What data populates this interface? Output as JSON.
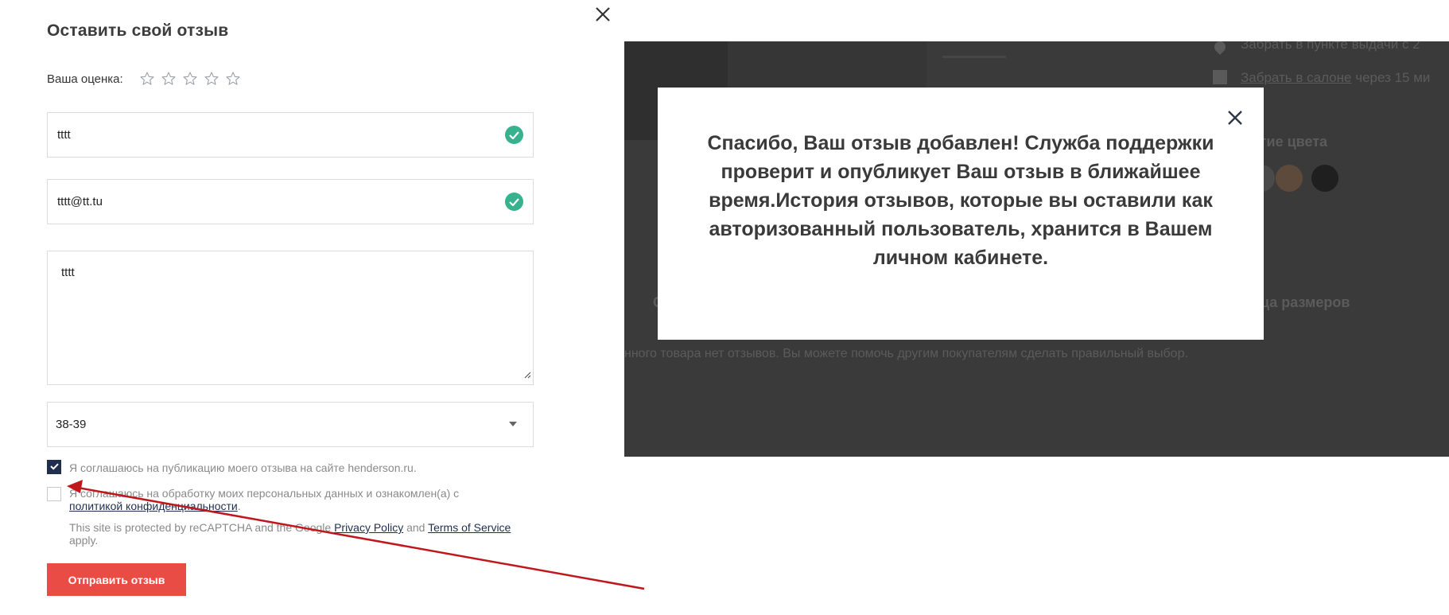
{
  "form": {
    "title": "Оставить свой отзыв",
    "rating_label": "Ваша оценка:",
    "stars": [
      {
        "name": "star-1-icon"
      },
      {
        "name": "star-2-icon"
      },
      {
        "name": "star-3-icon"
      },
      {
        "name": "star-4-icon"
      },
      {
        "name": "star-5-icon"
      }
    ],
    "rating_value": 0,
    "name_value": "tttt",
    "email_value": "tttt@tt.tu",
    "review_value": "tttt",
    "size_value": "38-39",
    "agree_publication": {
      "checked": true,
      "label": "Я соглашаюсь на публикацию моего отзыва на сайте henderson.ru."
    },
    "agree_personal": {
      "checked": false,
      "label_before": "Я соглашаюсь на обработку моих персональных данных и ознакомлен(а) с",
      "link": "политикой конфиденциальности",
      "label_after": "."
    },
    "recaptcha": {
      "before": "This site is protected by reCAPTCHA and the Google",
      "privacy_link": "Privacy Policy",
      "and": "and",
      "terms_link": "Terms of Service",
      "after": "apply."
    },
    "submit_label": "Отправить отзыв"
  },
  "background_page": {
    "pickup_point": "Забрать в пункте выдачи с 2",
    "store_link": "Забрать в салоне",
    "store_rest": "через 15 ми",
    "other_colors": "гие цвета",
    "letter_c": "С",
    "size_table": "ца размеров",
    "no_reviews": "нного товара нет отзывов. Вы можете помочь другим покупателям сделать правильный выбор.",
    "swatch_colors": [
      "#4a4a4a",
      "#5e4a3a",
      "#1f1f1f"
    ]
  },
  "dialog": {
    "message": "Спасибо, Ваш отзыв добавлен! Служба поддержки проверит и опубликует Ваш отзыв в ближайшее время.История отзывов, которые вы оставили как авторизованный пользователь, хранится в Вашем личном кабинете."
  },
  "colors": {
    "accent_red": "#e84c44",
    "check_green": "#37b18e",
    "navy": "#1f2f4d",
    "annotation_arrow": "#c0171d"
  }
}
